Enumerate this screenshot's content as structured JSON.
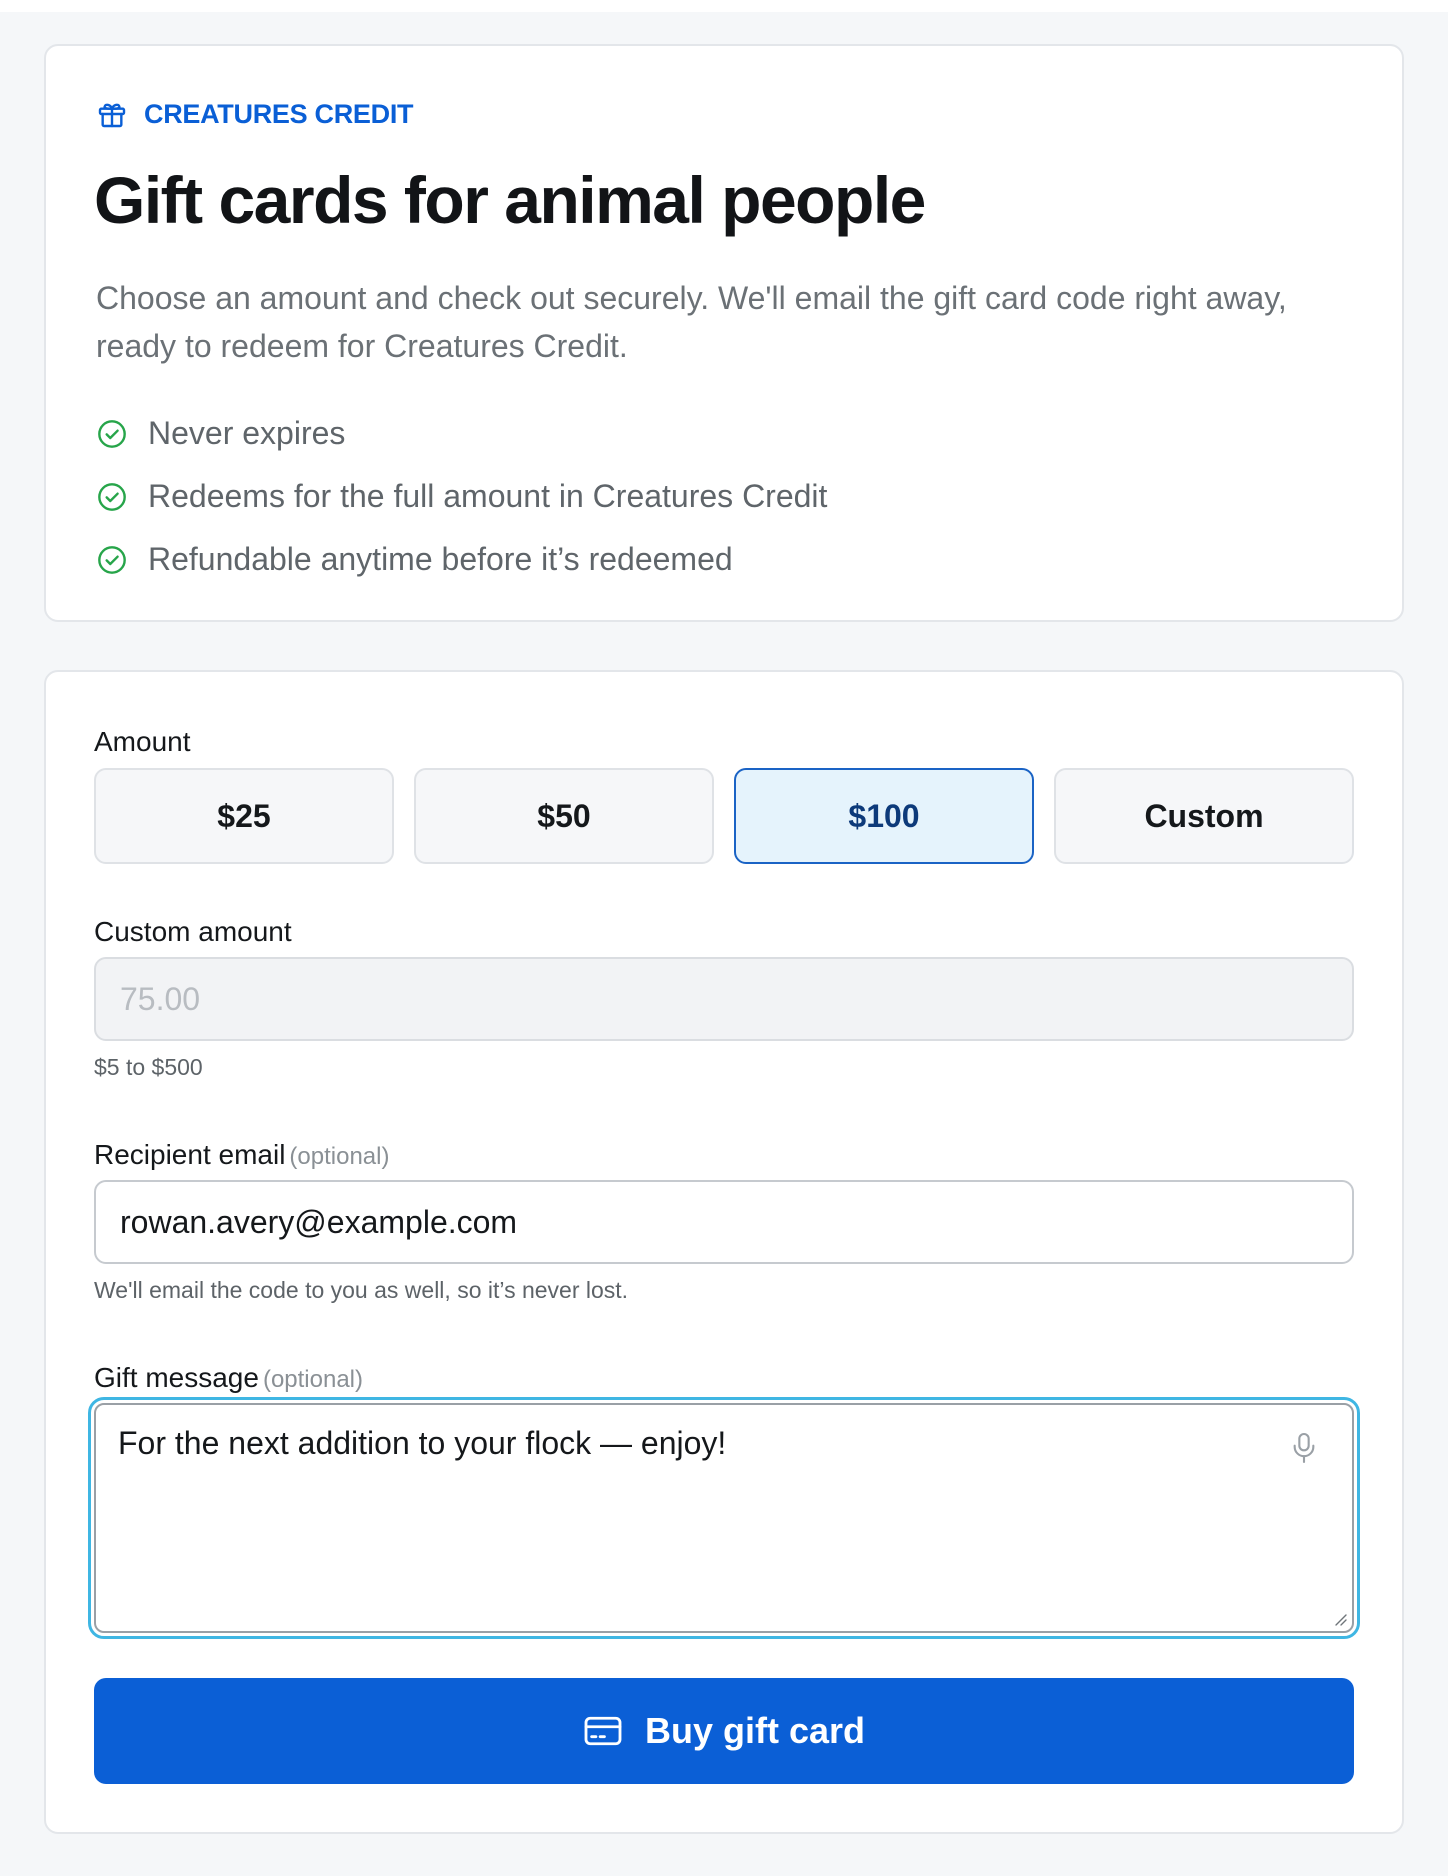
{
  "colors": {
    "accent": "#0b5fd6",
    "success": "#27a54a",
    "selected_bg": "#e5f3fc",
    "focus_ring": "#3fb6e3"
  },
  "hero": {
    "eyebrow_icon": "gift-icon",
    "eyebrow": "CREATURES CREDIT",
    "title": "Gift cards for animal people",
    "lead": "Choose an amount and check out securely. We'll email the gift card code right away, ready to redeem for Creatures Credit.",
    "benefit_icon": "check-circle-icon",
    "benefits": [
      "Never expires",
      "Redeems for the full amount in Creatures Credit",
      "Refundable anytime before it’s redeemed"
    ]
  },
  "form": {
    "amount_label": "Amount",
    "amounts": [
      "$25",
      "$50",
      "$100",
      "Custom"
    ],
    "selected_amount": "$100",
    "custom_amount_label": "Custom amount",
    "custom_amount_placeholder": "75.00",
    "custom_amount_help": "$5 to $500",
    "recipient_label": "Recipient email",
    "optional_tag": "(optional)",
    "recipient_value": "rowan.avery@example.com",
    "recipient_help": "We'll email the code to you as well, so it’s never lost.",
    "message_label": "Gift message",
    "message_value": "For the next addition to your flock — enjoy!",
    "message_icon": "microphone-icon",
    "submit_icon": "credit-card-icon",
    "submit_label": "Buy gift card"
  }
}
